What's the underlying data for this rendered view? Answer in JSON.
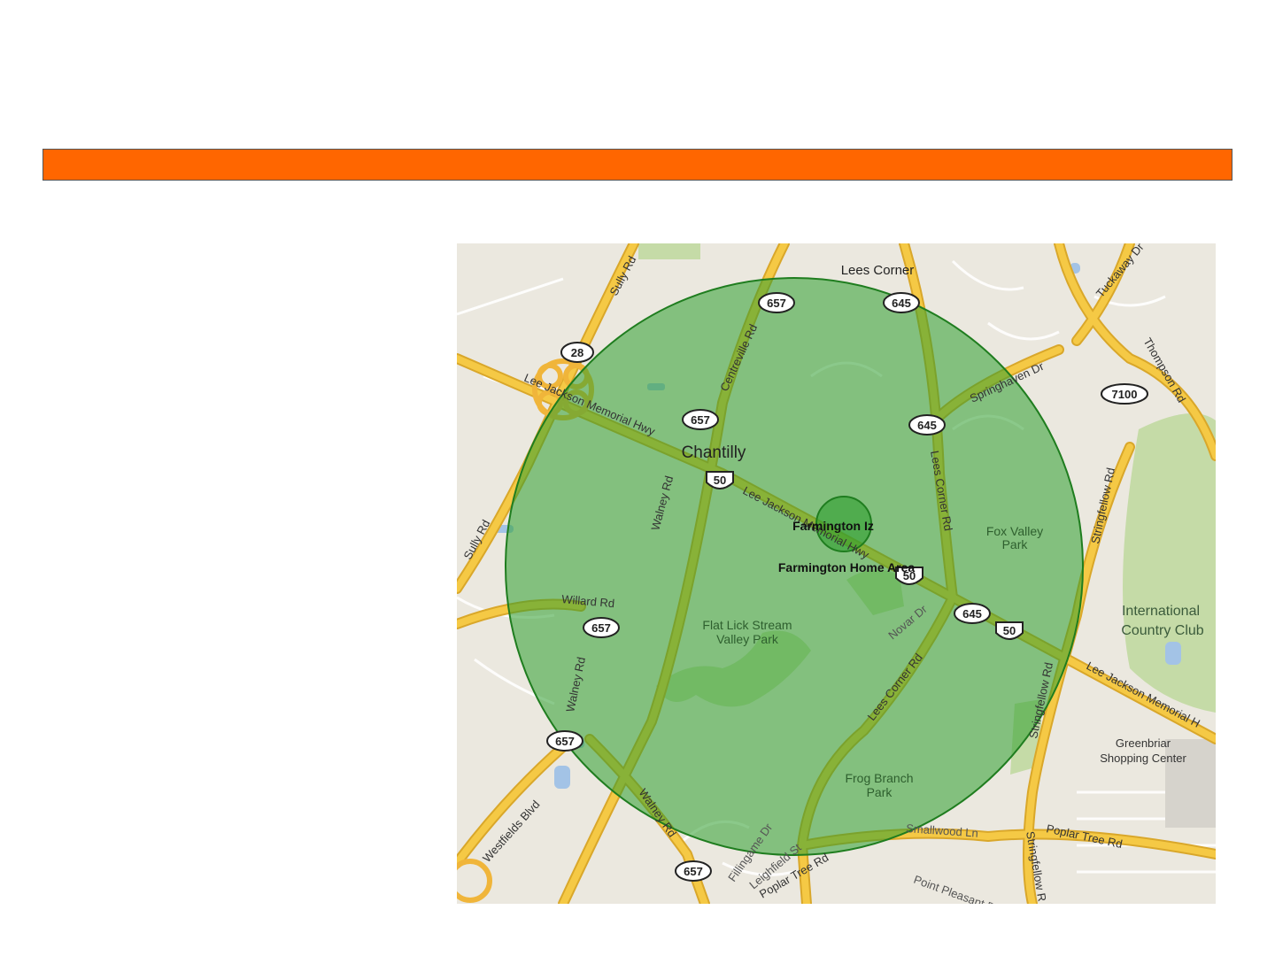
{
  "colors": {
    "header_bar": "#ff6600",
    "radius_fill": "#2e9e2e",
    "radius_stroke": "#1f7d1f",
    "land": "#ebe8df",
    "road_major": "#f5c945",
    "road_minor": "#ffffff",
    "park": "#c5dba7",
    "water": "#a3c3e6"
  },
  "map": {
    "places": {
      "lees_corner": "Lees Corner",
      "chantilly": "Chantilly",
      "farmington_iz": "Farmington Iz",
      "farmington_home": "Farmington Home Area",
      "fox_valley_1": "Fox Valley",
      "fox_valley_2": "Park",
      "flat_lick_1": "Flat Lick Stream",
      "flat_lick_2": "Valley Park",
      "frog_branch_1": "Frog Branch",
      "frog_branch_2": "Park",
      "intl_cc_1": "International",
      "intl_cc_2": "Country Club",
      "greenbriar_1": "Greenbriar",
      "greenbriar_2": "Shopping Center"
    },
    "roads": {
      "sully_rd_top": "Sully Rd",
      "sully_rd_left": "Sully Rd",
      "lee_jackson_1": "Lee Jackson Memorial Hwy",
      "lee_jackson_2": "Lee Jackson Memorial Hwy",
      "lee_jackson_3": "Lee Jackson Memorial H",
      "centreville_rd": "Centreville Rd",
      "walney_rd_1": "Walney Rd",
      "walney_rd_2": "Walney Rd",
      "walney_rd_3": "Walney Rd",
      "willard_rd": "Willard Rd",
      "lees_corner_rd_1": "Lees Corner Rd",
      "lees_corner_rd_2": "Lees Corner Rd",
      "springhaven_dr": "Springhaven Dr",
      "stringfellow_rd_1": "Stringfellow Rd",
      "stringfellow_rd_2": "Stringfellow Rd",
      "stringfellow_rd_3": "Stringfellow R",
      "tuckaway_dr": "Tuckaway Dr",
      "thompson_rd": "Thompson Rd",
      "westfields_blvd": "Westfields Blvd",
      "poplar_tree_rd_1": "Poplar Tree Rd",
      "poplar_tree_rd_2": "Poplar Tree Rd",
      "novar_dr": "Novar Dr",
      "smallwood_ln": "Smallwood Ln",
      "fillingame_dr": "Fillingame Dr",
      "leighfield_st": "Leighfield St",
      "point_pleasant": "Point Pleasant D"
    },
    "shields": {
      "r28": "28",
      "r657_a": "657",
      "r657_b": "657",
      "r657_c": "657",
      "r657_d": "657",
      "r657_e": "657",
      "r645_a": "645",
      "r645_b": "645",
      "r645_c": "645",
      "r7100": "7100",
      "us50_a": "50",
      "us50_b": "50",
      "us50_c": "50"
    }
  }
}
